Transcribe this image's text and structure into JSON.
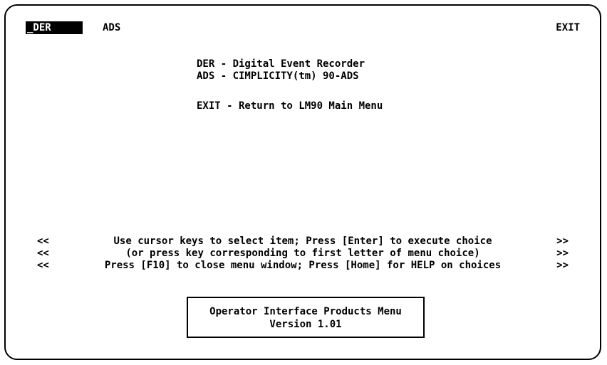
{
  "menu": {
    "items": [
      {
        "label": "_DER",
        "selected": true
      },
      {
        "label": "ADS",
        "selected": false
      }
    ],
    "exit_label": "EXIT"
  },
  "descriptions": [
    "DER - Digital Event Recorder",
    "ADS - CIMPLICITY(tm) 90-ADS",
    "EXIT - Return to LM90 Main Menu"
  ],
  "hints": [
    {
      "left": "<<",
      "text": "Use cursor keys to select item; Press [Enter] to execute choice",
      "right": ">>"
    },
    {
      "left": "<<",
      "text": "(or press key corresponding to first letter of menu choice)",
      "right": ">>"
    },
    {
      "left": "<<",
      "text": "Press [F10] to close menu window; Press [Home] for HELP on choices",
      "right": ">>"
    }
  ],
  "info": {
    "title": "Operator Interface Products Menu",
    "version": "Version 1.01"
  },
  "colors": {
    "background": "#ffffff",
    "foreground": "#000000",
    "selected_bg": "#000000",
    "selected_fg": "#ffffff"
  }
}
